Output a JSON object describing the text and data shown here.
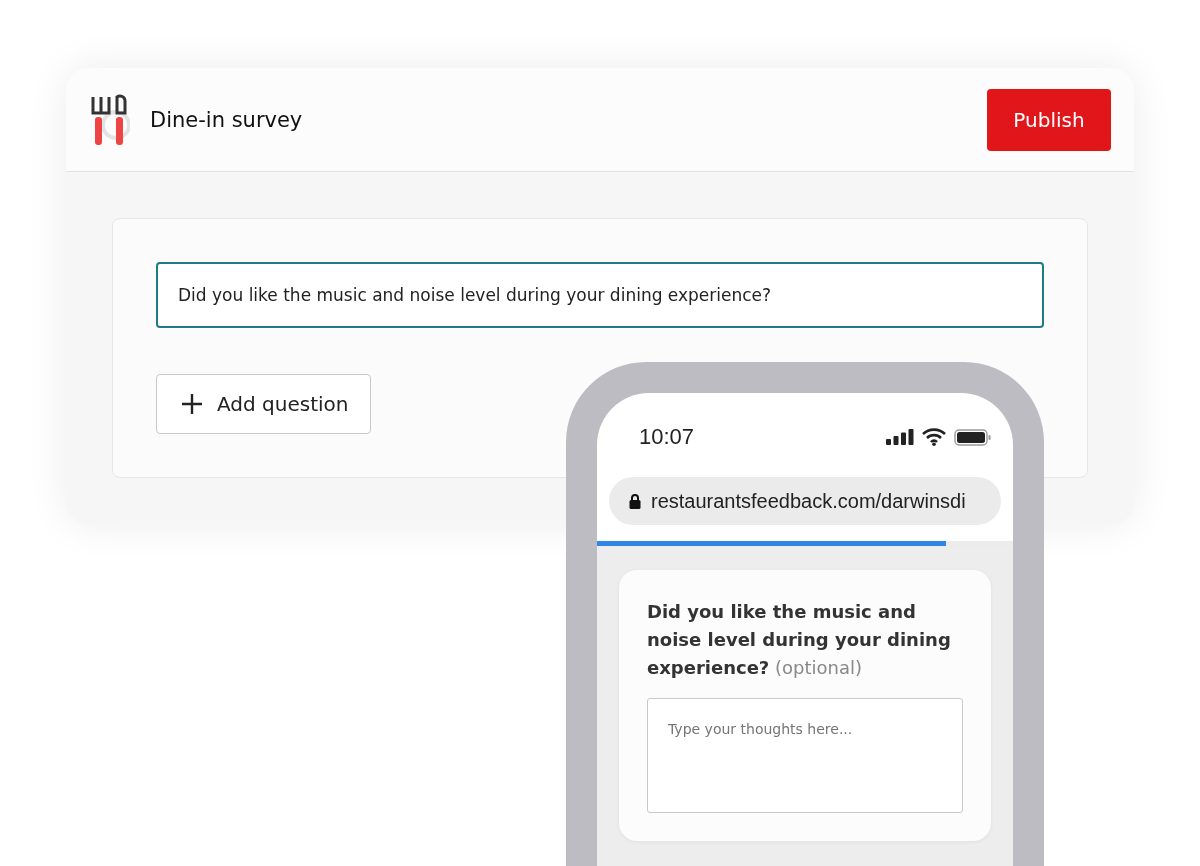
{
  "header": {
    "title": "Dine-in survey",
    "publish_button": "Publish"
  },
  "editor": {
    "question_value": "Did you like the music and noise level during your dining experience?",
    "add_button": "Add question"
  },
  "phone": {
    "time": "10:07",
    "url": "restaurantsfeedback.com/darwinsdi",
    "progress": {
      "level": 0.84
    },
    "card": {
      "question": "**Did you like the music and noise level during your dining experience?** (optional)",
      "answer_placeholder": "Type your thoughts here..."
    }
  }
}
